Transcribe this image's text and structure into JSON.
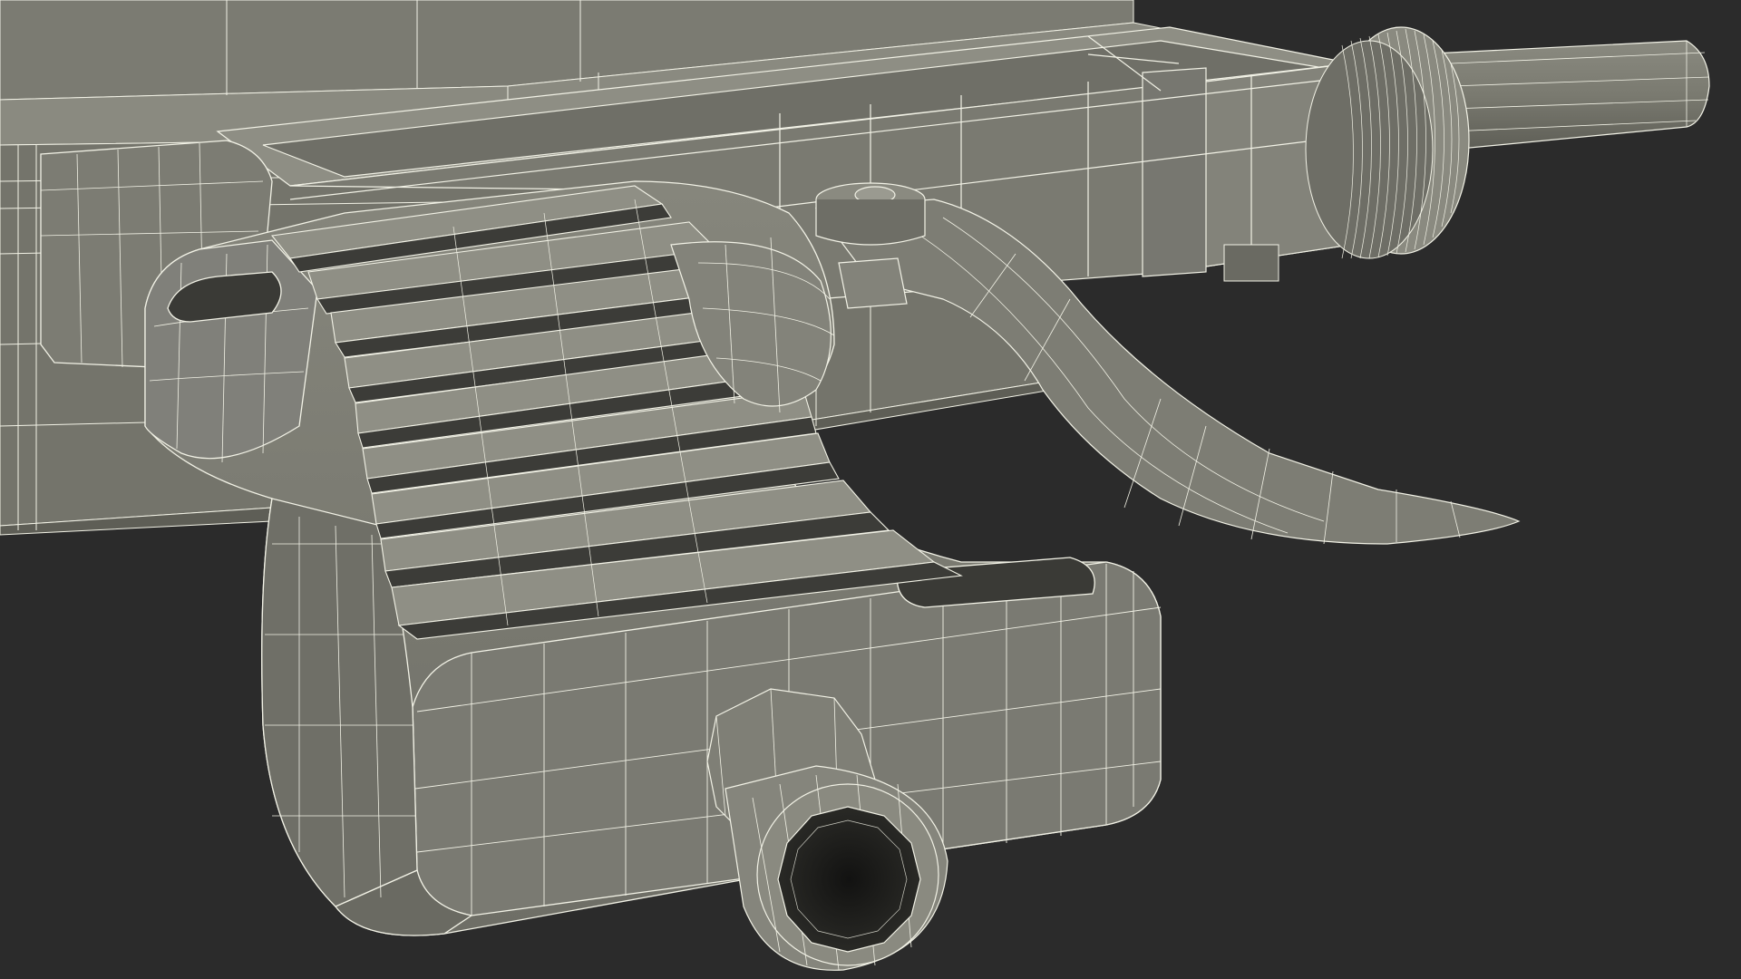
{
  "scene": {
    "background_color": "#2b2b2b",
    "surface_color": "#7d7d73",
    "surface_shadow_color": "#5f5f57",
    "surface_dark_color": "#4a4a44",
    "wire_color": "#f2f2e6",
    "cavity_color": "#1e1e1c"
  }
}
